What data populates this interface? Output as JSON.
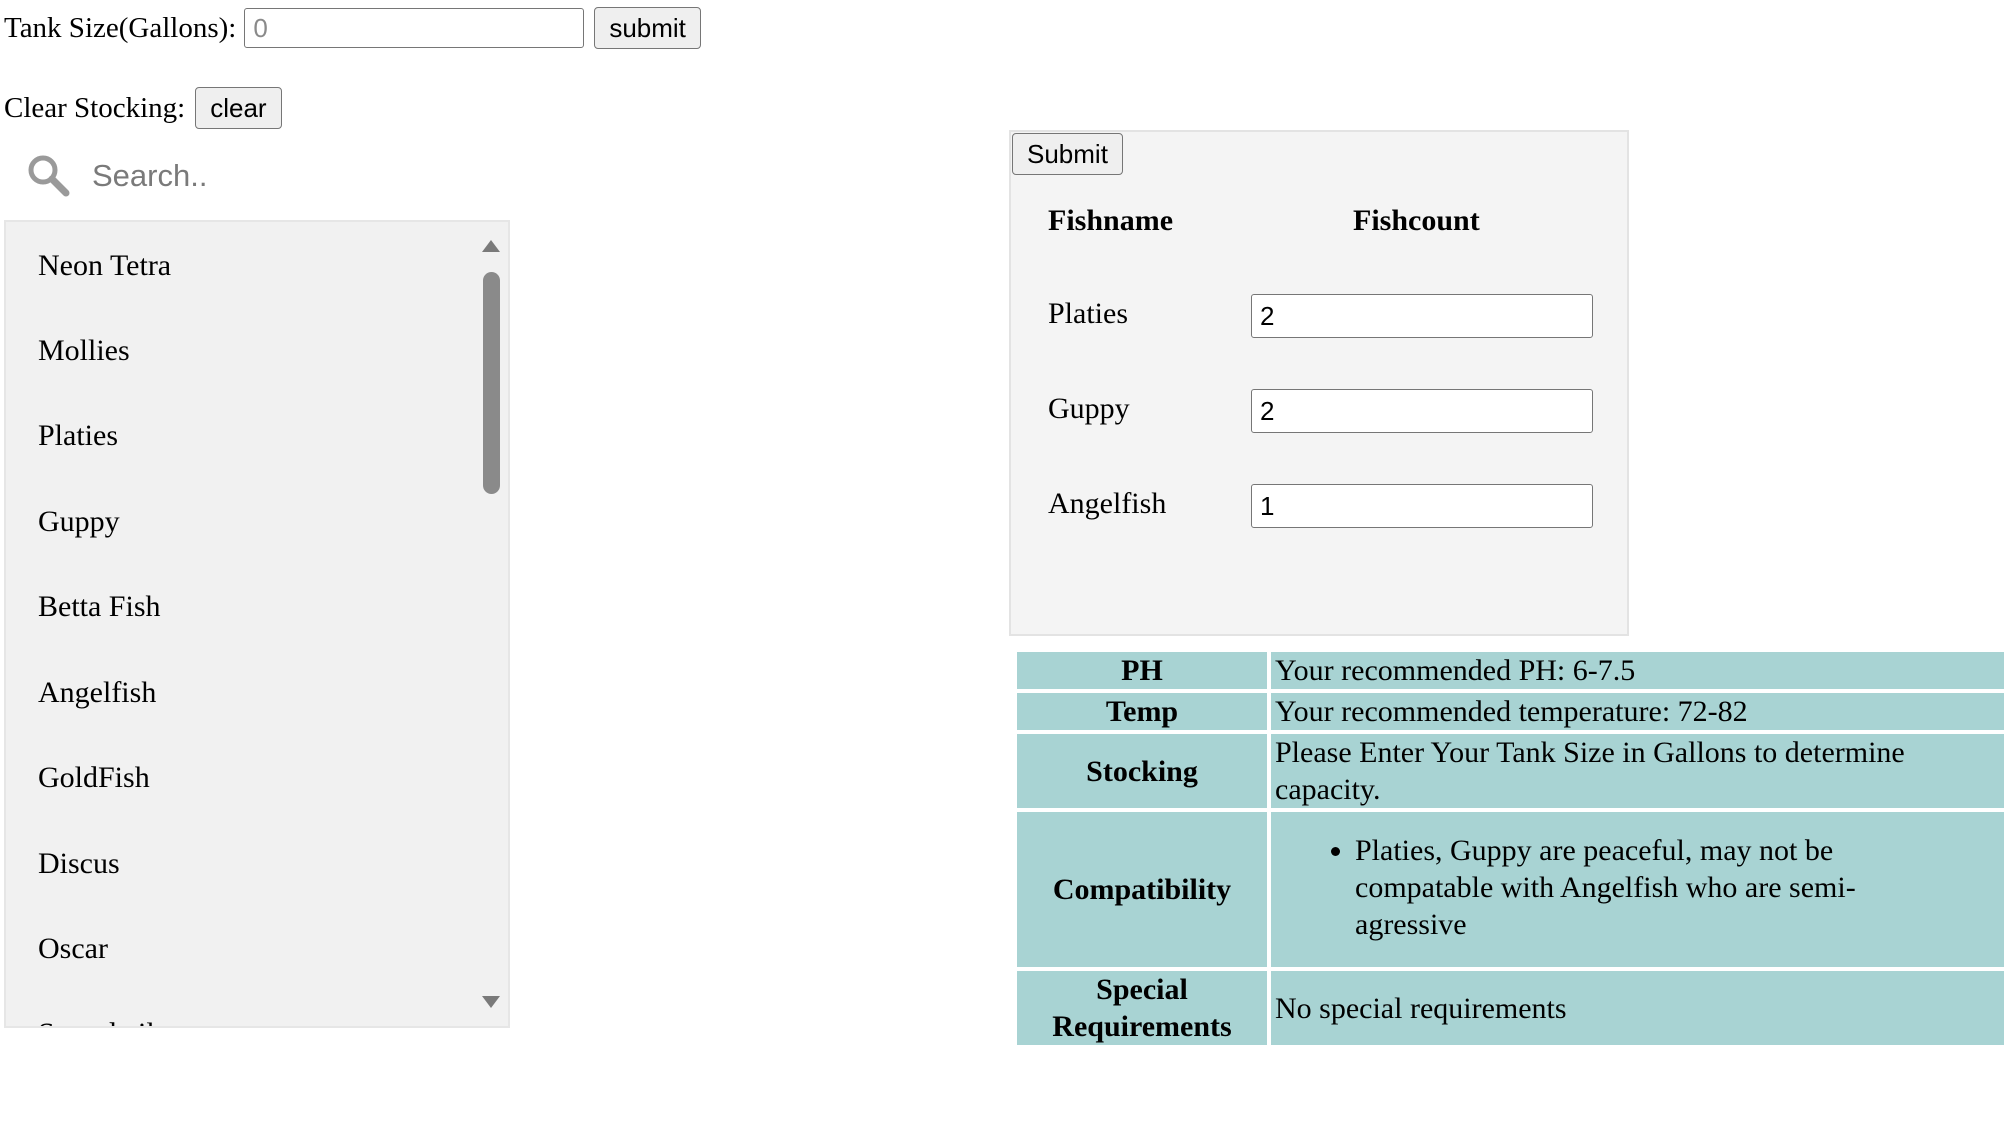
{
  "tank": {
    "label": "Tank Size(Gallons):",
    "placeholder": "0",
    "value": "",
    "submit_label": "submit"
  },
  "clear": {
    "label": "Clear Stocking:",
    "button_label": "clear"
  },
  "search": {
    "icon": "search-icon",
    "placeholder": "Search.."
  },
  "fish_list": {
    "items": [
      "Neon Tetra",
      "Mollies",
      "Platies",
      "Guppy",
      "Betta Fish",
      "Angelfish",
      "GoldFish",
      "Discus",
      "Oscar",
      "Swordtail"
    ]
  },
  "stocking_form": {
    "submit_label": "Submit",
    "header_name": "Fishname",
    "header_count": "Fishcount",
    "rows": [
      {
        "name": "Platies",
        "count": "2"
      },
      {
        "name": "Guppy",
        "count": "2"
      },
      {
        "name": "Angelfish",
        "count": "1"
      }
    ]
  },
  "info": {
    "accent_color": "#a8d3d3",
    "rows": [
      {
        "label": "PH",
        "value": "Your recommended PH: 6-7.5"
      },
      {
        "label": "Temp",
        "value": "Your recommended temperature: 72-82"
      },
      {
        "label": "Stocking",
        "value": "Please Enter Your Tank Size in Gallons to determine capacity."
      },
      {
        "label": "Compatibility",
        "items": [
          "Platies, Guppy are peaceful, may not be compatable with Angelfish who are semi-agressive"
        ]
      },
      {
        "label": "Special Requirements",
        "value": "No special requirements"
      }
    ]
  }
}
